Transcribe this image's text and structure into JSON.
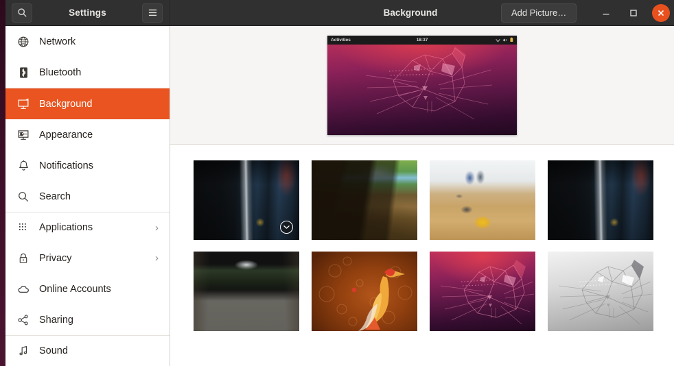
{
  "window": {
    "app_title": "Settings",
    "panel_title": "Background",
    "add_picture_label": "Add Picture…",
    "search_icon": "search-icon",
    "menu_icon": "hamburger-menu-icon",
    "minimize_icon": "minimize-icon",
    "maximize_icon": "maximize-icon",
    "close_icon": "close-icon",
    "accent_color": "#e95420",
    "headerbar_color": "#303030",
    "close_button_color": "#e8501e"
  },
  "sidebar": {
    "items": [
      {
        "label": "Network",
        "icon": "globe-icon",
        "selected": false,
        "chevron": false,
        "separator_above": false
      },
      {
        "label": "Bluetooth",
        "icon": "bluetooth-icon",
        "selected": false,
        "chevron": false,
        "separator_above": false
      },
      {
        "label": "Background",
        "icon": "monitor-icon",
        "selected": true,
        "chevron": false,
        "separator_above": true
      },
      {
        "label": "Appearance",
        "icon": "appearance-icon",
        "selected": false,
        "chevron": false,
        "separator_above": false
      },
      {
        "label": "Notifications",
        "icon": "bell-icon",
        "selected": false,
        "chevron": false,
        "separator_above": false
      },
      {
        "label": "Search",
        "icon": "search-icon",
        "selected": false,
        "chevron": false,
        "separator_above": false
      },
      {
        "label": "Applications",
        "icon": "grid-dots-icon",
        "selected": false,
        "chevron": true,
        "separator_above": true
      },
      {
        "label": "Privacy",
        "icon": "lock-icon",
        "selected": false,
        "chevron": true,
        "separator_above": false
      },
      {
        "label": "Online Accounts",
        "icon": "cloud-icon",
        "selected": false,
        "chevron": false,
        "separator_above": false
      },
      {
        "label": "Sharing",
        "icon": "share-nodes-icon",
        "selected": false,
        "chevron": false,
        "separator_above": false
      },
      {
        "label": "Sound",
        "icon": "music-note-icon",
        "selected": false,
        "chevron": false,
        "separator_above": true
      }
    ],
    "chevron_glyph": "›"
  },
  "preview": {
    "activities_label": "Activities",
    "clock": "18:37",
    "system_icons": [
      "wifi-icon",
      "volume-icon",
      "battery-icon"
    ],
    "wallpaper": "ubuntu-focal-fossa-dark"
  },
  "wallpapers": [
    {
      "name": "subway-platform",
      "style": "w-subway",
      "selected": true,
      "badge_icon": "chevron-down-circle-icon"
    },
    {
      "name": "forest-shadows",
      "style": "w-forest",
      "selected": false,
      "badge_icon": null
    },
    {
      "name": "shuffleboard-table",
      "style": "w-shuffle",
      "selected": false,
      "badge_icon": null
    },
    {
      "name": "subway-platform-alt",
      "style": "w-subway",
      "selected": false,
      "badge_icon": null
    },
    {
      "name": "suspension-bridge",
      "style": "w-bridge",
      "selected": false,
      "badge_icon": null
    },
    {
      "name": "orange-heron",
      "style": "w-heron",
      "selected": false,
      "badge_icon": null
    },
    {
      "name": "focal-fossa-dark",
      "style": "ff-dark",
      "selected": false,
      "badge_icon": null
    },
    {
      "name": "focal-fossa-light",
      "style": "ff-light",
      "selected": false,
      "badge_icon": null
    }
  ]
}
